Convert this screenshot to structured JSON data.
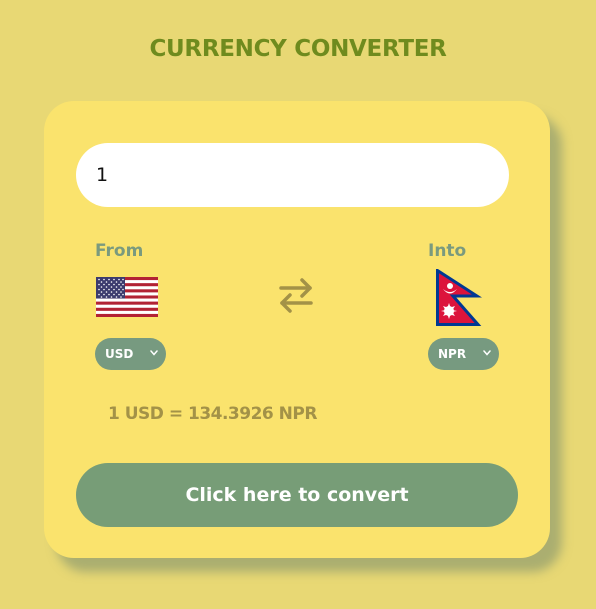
{
  "header": {
    "title": "CURRENCY CONVERTER"
  },
  "converter": {
    "amount_value": "1",
    "from_label": "From",
    "into_label": "Into",
    "from_currency": "USD",
    "into_currency": "NPR",
    "from_flag": "us-flag-icon",
    "into_flag": "nepal-flag-icon",
    "swap_icon": "swap-arrows-icon",
    "rate_text": "1 USD = 134.3926 NPR",
    "convert_label": "Click here to convert"
  },
  "colors": {
    "background": "#e8d874",
    "card": "#fae36d",
    "title": "#6f8b1e",
    "label": "#7a9a7e",
    "select": "#779a80",
    "rate": "#a39247",
    "button": "#779d77",
    "swap_icon": "#a39247"
  }
}
